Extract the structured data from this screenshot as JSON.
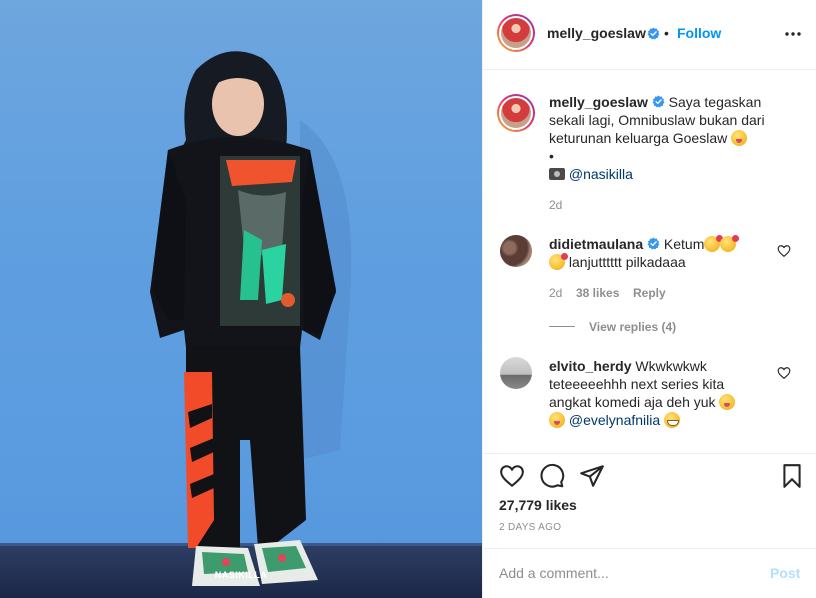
{
  "photo": {
    "watermark": "NASIKILLA"
  },
  "header": {
    "username": "melly_goeslaw",
    "separator": "•",
    "follow_label": "Follow"
  },
  "caption": {
    "username": "melly_goeslaw",
    "text": "Saya tegaskan sekali lagi, Omnibuslaw bukan dari keturunan keluarga Goeslaw",
    "bullet": "•",
    "credit_mention": "@nasikilla",
    "time": "2d"
  },
  "comments": [
    {
      "username": "didietmaulana",
      "text_1": "Ketum",
      "text_2": "lanjutttttt pilkadaaa",
      "time": "2d",
      "likes": "38 likes",
      "reply_label": "Reply",
      "view_replies": "View replies (4)"
    },
    {
      "username": "elvito_herdy",
      "text_1": "Wkwkwkwk teteeeeehhh next series kita angkat komedi aja deh yuk",
      "mention": "@evelynafnilia"
    }
  ],
  "stats": {
    "likes": "27,779 likes",
    "date": "2 DAYS AGO"
  },
  "comment_box": {
    "placeholder": "Add a comment...",
    "post_label": "Post"
  },
  "icons": {
    "verified": "verified-badge-icon",
    "more": "more-options-icon",
    "heart": "heart-icon",
    "comment": "comment-icon",
    "share": "share-icon",
    "save": "bookmark-icon"
  },
  "colors": {
    "link_blue": "#0095f6",
    "verified_blue": "#3897f0",
    "post_disabled": "#b2dffc",
    "muted_text": "#8e8e8e",
    "wall_blue": "#5f9fe0"
  }
}
